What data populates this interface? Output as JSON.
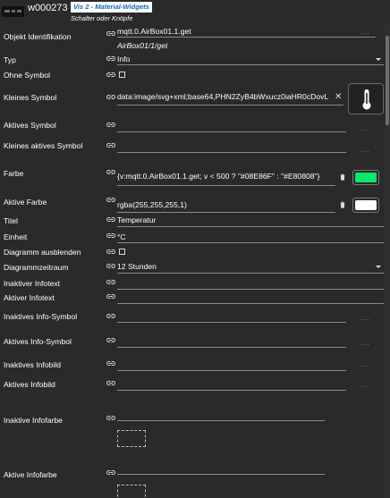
{
  "header": {
    "widget_id": "w000273",
    "set_badge": "Vis 2 - Material-Widgets",
    "subtitle": "Schalter oder Knöpfe"
  },
  "fields": {
    "object_id": {
      "label": "Objekt Identifikation",
      "value": "mqtt.0.AirBox01.1.get",
      "hint": "AirBox01/1/get"
    },
    "type": {
      "label": "Typ",
      "value": "Info"
    },
    "no_icon": {
      "label": "Ohne Symbol",
      "checked": false
    },
    "small_icon": {
      "label": "Kleines Symbol",
      "value": "data:image/svg+xml;base64,PHN2ZyB4bWxucz0iaHR0cDovL",
      "preview_icon": "thermometer-icon"
    },
    "active_icon": {
      "label": "Aktives Symbol"
    },
    "small_active_icon": {
      "label": "Kleines aktives Symbol"
    },
    "color": {
      "label": "Farbe",
      "value": "{v:mqtt.0.AirBox01.1.get; v < 500 ? \"#08E86F\" : \"#E80808\"}",
      "swatch": "#08E86F"
    },
    "active_color": {
      "label": "Aktive Farbe",
      "value": "rgba(255,255,255,1)",
      "swatch": "#ffffff"
    },
    "title": {
      "label": "Titel",
      "value": "Temperatur"
    },
    "unit": {
      "label": "Einheit",
      "value": "°C"
    },
    "hide_chart": {
      "label": "Diagramm ausblenden",
      "checked": false
    },
    "chart_period": {
      "label": "Diagrammzeitraum",
      "value": "12 Stunden"
    },
    "inactive_info_text": {
      "label": "Inaktiver Infotext"
    },
    "active_info_text": {
      "label": "Aktiver Infotext"
    },
    "inactive_info_icon": {
      "label": "Inaktives Info-Symbol"
    },
    "active_info_icon": {
      "label": "Aktives Info-Symbol"
    },
    "inactive_info_image": {
      "label": "Inaktives Infobild"
    },
    "active_info_image": {
      "label": "Aktives Infobild"
    },
    "inactive_info_color": {
      "label": "Inaktive Infofarbe"
    },
    "active_info_color": {
      "label": "Aktive Infofarbe"
    }
  },
  "colors": {
    "accent": "#3b8be8",
    "badge_text": "#1565c0"
  },
  "icons": {
    "link": "link-icon",
    "delete": "trash-icon",
    "browse": "more-dots-icon",
    "clear": "close-icon",
    "dropdown": "caret-down-icon"
  }
}
